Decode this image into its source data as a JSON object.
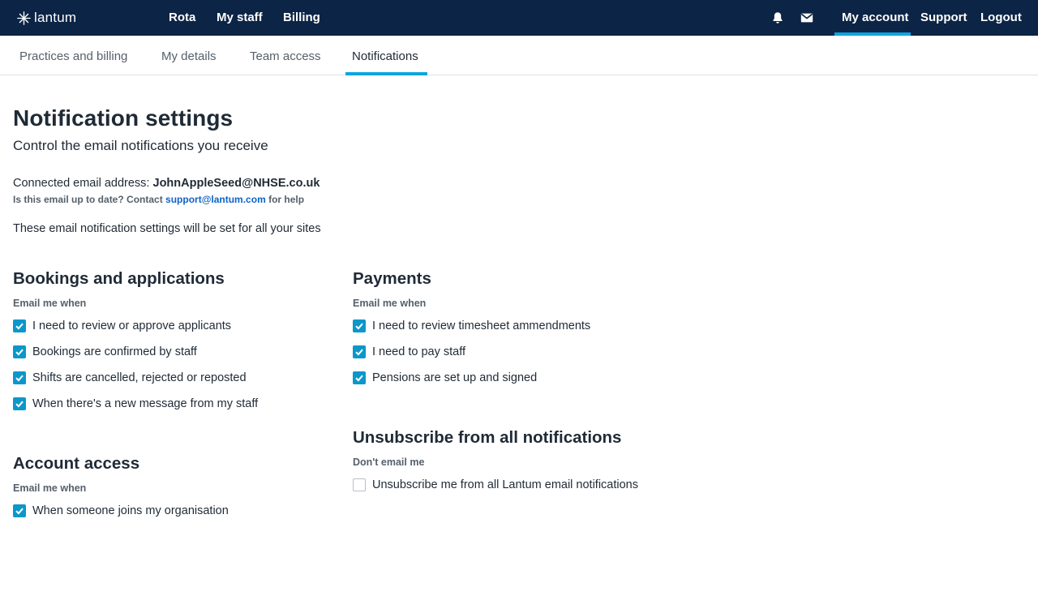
{
  "brand": {
    "name": "lantum",
    "color": "#0c2445",
    "accent": "#0ea5dd",
    "checkbox_color": "#0b97c9",
    "link_color": "#0e63c6"
  },
  "topnav": {
    "left": [
      "Rota",
      "My staff",
      "Billing"
    ],
    "icons": [
      "bell-icon",
      "mail-icon"
    ],
    "right": [
      "My account",
      "Support",
      "Logout"
    ],
    "active": "My account"
  },
  "subnav": {
    "tabs": [
      "Practices and billing",
      "My details",
      "Team access",
      "Notifications"
    ],
    "active": "Notifications"
  },
  "main": {
    "title": "Notification settings",
    "subtitle": "Control the email notifications you receive",
    "email_label": "Connected email address:",
    "email_value": "JohnAppleSeed@NHSE.co.uk",
    "email_help_prefix": "Is this email up to date? Contact",
    "email_help_link": "support@lantum.com",
    "email_help_suffix": "for help",
    "scope_note": "These email notification settings will be set for all your sites"
  },
  "sections": {
    "bookings": {
      "title": "Bookings and applications",
      "caption": "Email me when",
      "options": [
        {
          "label": "I need to review or approve applicants",
          "checked": true
        },
        {
          "label": "Bookings are confirmed by staff",
          "checked": true
        },
        {
          "label": "Shifts are cancelled, rejected or reposted",
          "checked": true
        },
        {
          "label": "When there's a new message from my staff",
          "checked": true
        }
      ]
    },
    "account": {
      "title": "Account access",
      "caption": "Email me when",
      "options": [
        {
          "label": "When someone joins my organisation",
          "checked": true
        }
      ]
    },
    "payments": {
      "title": "Payments",
      "caption": "Email me when",
      "options": [
        {
          "label": "I need to review timesheet ammendments",
          "checked": true
        },
        {
          "label": "I need to pay staff",
          "checked": true
        },
        {
          "label": "Pensions are set up and signed",
          "checked": true
        }
      ]
    },
    "unsubscribe": {
      "title": "Unsubscribe from all notifications",
      "caption": "Don't email me",
      "options": [
        {
          "label": "Unsubscribe me from all Lantum email notifications",
          "checked": false
        }
      ]
    }
  }
}
